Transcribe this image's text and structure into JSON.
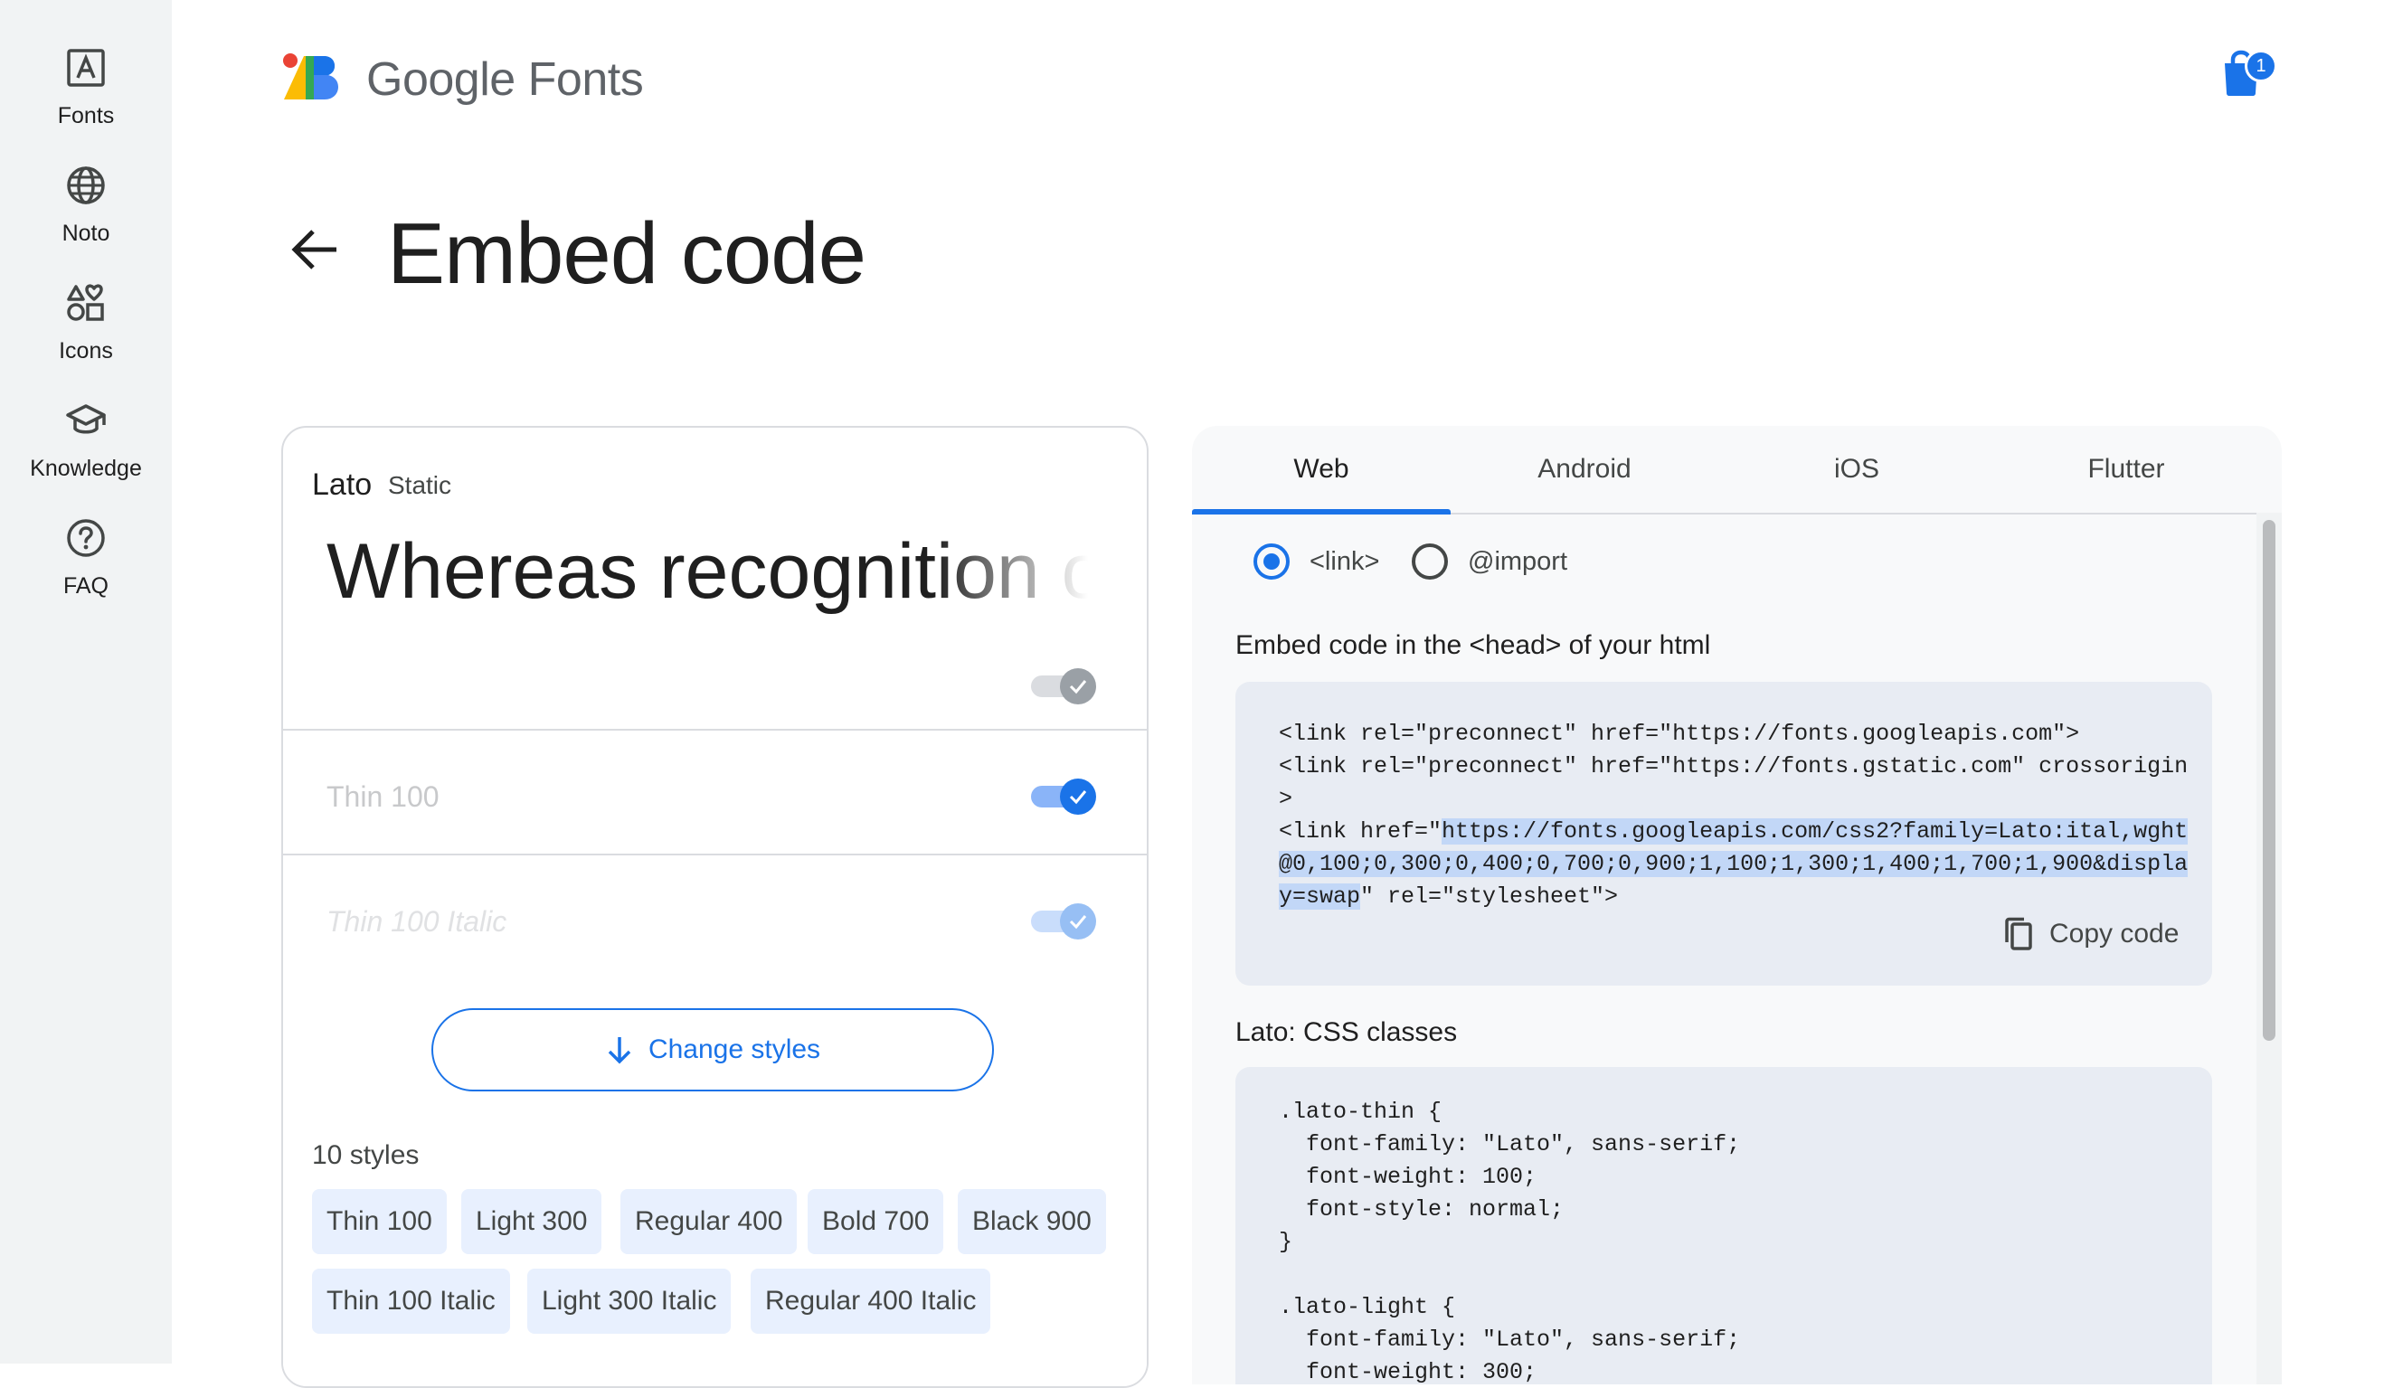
{
  "nav": {
    "items": [
      {
        "label": "Fonts",
        "icon": "font-icon"
      },
      {
        "label": "Noto",
        "icon": "globe-icon"
      },
      {
        "label": "Icons",
        "icon": "shapes-icon"
      },
      {
        "label": "Knowledge",
        "icon": "graduation-cap-icon"
      },
      {
        "label": "FAQ",
        "icon": "help-circle-icon"
      }
    ]
  },
  "header": {
    "brand_google": "Google",
    "brand_fonts": "Fonts",
    "bag_count": "1"
  },
  "page": {
    "title": "Embed code"
  },
  "font_card": {
    "family": "Lato",
    "type": "Static",
    "preview_text": "Whereas recognition of the inherent dignity",
    "styles_visible": [
      "Thin 100",
      "Thin 100 Italic"
    ],
    "change_styles_label": "Change styles",
    "styles_count": "10 styles",
    "chips": [
      "Thin 100",
      "Light 300",
      "Regular 400",
      "Bold 700",
      "Black 900",
      "Thin 100 Italic",
      "Light 300 Italic",
      "Regular 400 Italic"
    ]
  },
  "embed": {
    "tabs": [
      "Web",
      "Android",
      "iOS",
      "Flutter"
    ],
    "active_tab": "Web",
    "radio_options": [
      "<link>",
      "@import"
    ],
    "selected_option": "<link>",
    "head_section_title": "Embed code in the <head> of your html",
    "code_lines": [
      "<link rel=\"preconnect\" href=\"https://fonts.googleapis.com\">",
      "<link rel=\"preconnect\" href=\"https://fonts.gstatic.com\" crossorigin",
      ">"
    ],
    "code_line4_pre": "<link href=\"",
    "code_line4_hl": "https://fonts.googleapis.com/css2?family=Lato:ital,wght",
    "code_line5_hl": "@0,100;0,300;0,400;0,700;0,900;1,100;1,300;1,400;1,700;1,900&displa",
    "code_line6_hl": "y=swap",
    "code_line6_post": "\" rel=\"stylesheet\">",
    "copy_label": "Copy code",
    "css_section_title": "Lato: CSS classes",
    "css_code": ".lato-thin {\n  font-family: \"Lato\", sans-serif;\n  font-weight: 100;\n  font-style: normal;\n}\n\n.lato-light {\n  font-family: \"Lato\", sans-serif;\n  font-weight: 300;"
  },
  "colors": {
    "accent": "#1a73e8",
    "rail_bg": "#f1f3f4",
    "code_bg": "#e8ecf3",
    "chip_bg": "#e8f0fe",
    "highlight": "#c2d7f7"
  }
}
